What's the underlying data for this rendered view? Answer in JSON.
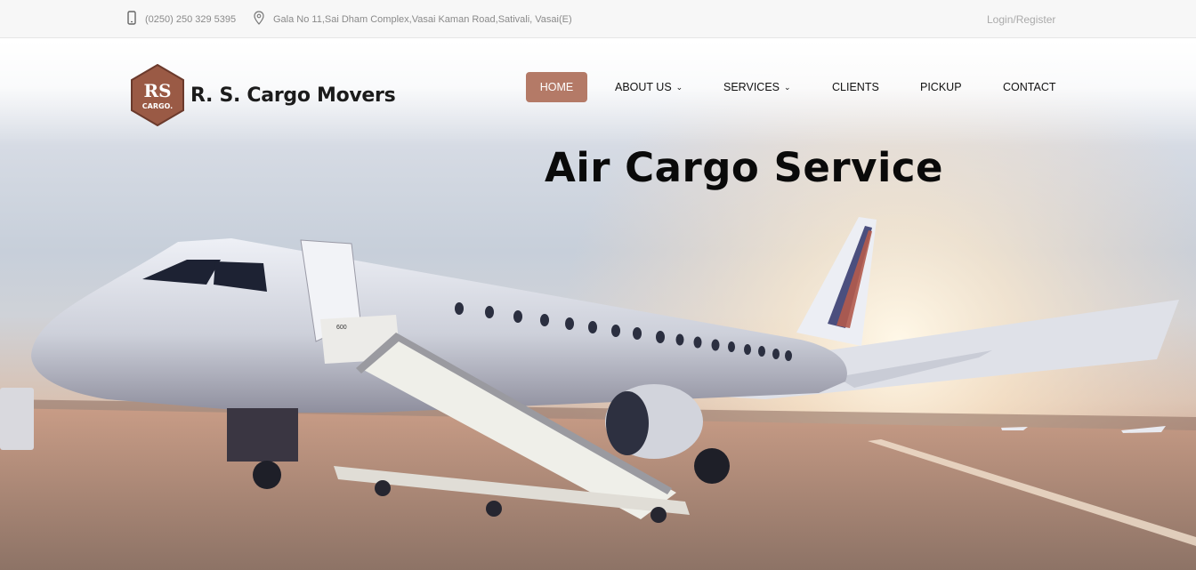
{
  "topbar": {
    "phone": "(0250) 250 329 5395",
    "address": "Gala No 11,Sai Dham Complex,Vasai Kaman Road,Sativali, Vasai(E)",
    "login": "Login/Register"
  },
  "brand": {
    "logo_initials": "RS",
    "logo_sub": "CARGO.",
    "name": "R. S. Cargo Movers",
    "accent_color": "#b47a67"
  },
  "nav": {
    "home": "HOME",
    "about": "ABOUT US",
    "services": "SERVICES",
    "clients": "CLIENTS",
    "pickup": "PICKUP",
    "contact": "CONTACT"
  },
  "hero": {
    "headline": "Air Cargo Service",
    "aircraft_number": "600"
  }
}
